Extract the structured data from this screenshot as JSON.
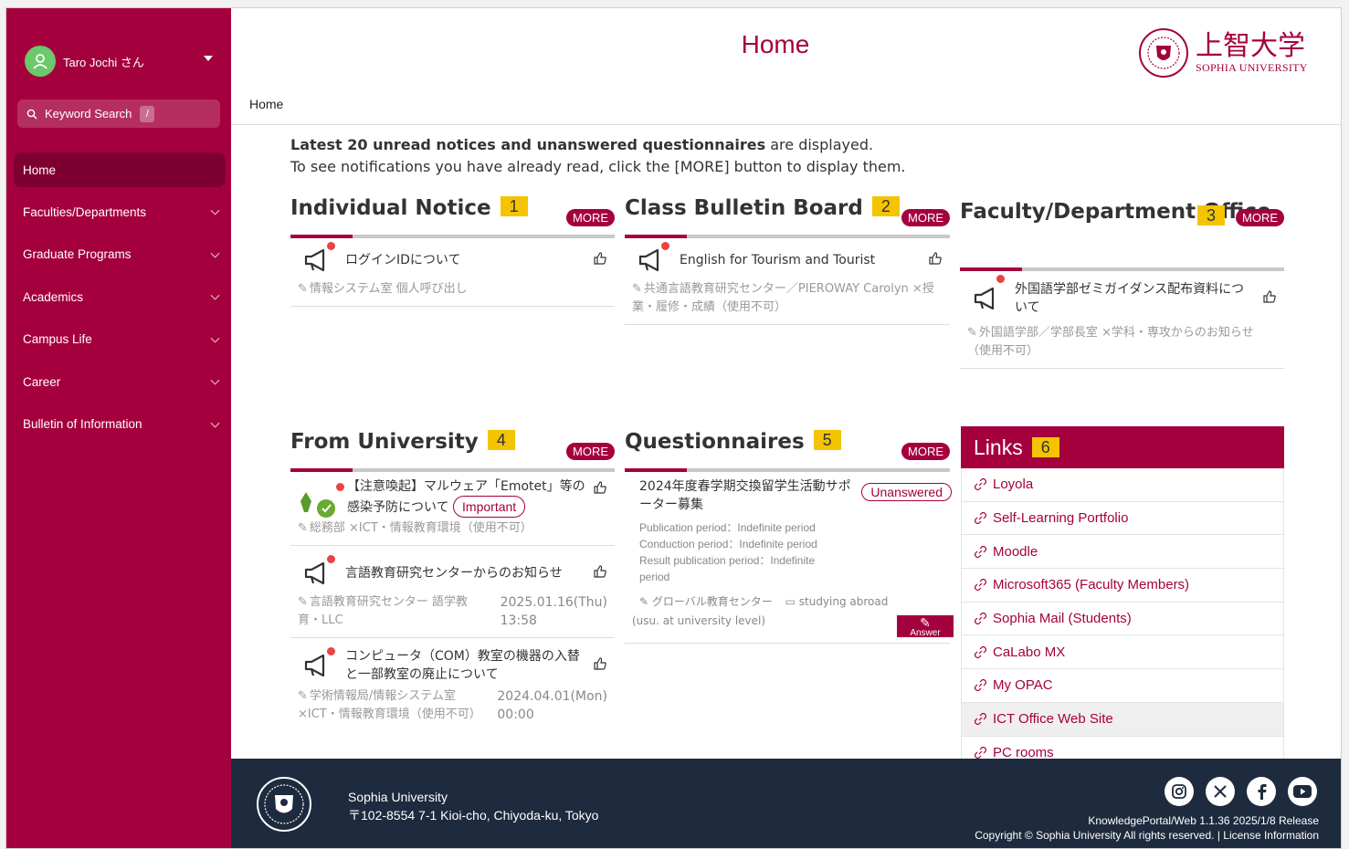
{
  "user": {
    "name": "Taro Jochi さん"
  },
  "search": {
    "label": "Keyword Search",
    "shortcut": "/"
  },
  "nav": [
    {
      "label": "Home"
    },
    {
      "label": "Faculties/Departments"
    },
    {
      "label": "Graduate Programs"
    },
    {
      "label": "Academics"
    },
    {
      "label": "Campus Life"
    },
    {
      "label": "Career"
    },
    {
      "label": "Bulletin of Information"
    }
  ],
  "header": {
    "title": "Home",
    "breadcrumb": "Home",
    "logo_jp": "上智大学",
    "logo_en": "SOPHIA UNIVERSITY"
  },
  "intro": {
    "bold": "Latest 20 unread notices and unanswered questionnaires",
    "rest": " are displayed.",
    "line2": "To see notifications you have already read, click the [MORE] button to display them."
  },
  "more_label": "MORE",
  "panels": {
    "individual": {
      "title": "Individual Notice",
      "num": "1",
      "items": [
        {
          "title": "ログインIDについて",
          "meta": "情報システム室 個人呼び出し"
        }
      ]
    },
    "class": {
      "title": "Class Bulletin Board",
      "num": "2",
      "items": [
        {
          "title": "English for Tourism and Tourist",
          "meta": "共通言語教育研究センター／PIEROWAY Carolyn ×授業・履修・成績（使用不可）"
        }
      ]
    },
    "faculty": {
      "title": "Faculty/Department Office",
      "num": "3",
      "items": [
        {
          "title": "外国語学部ゼミガイダンス配布資料について",
          "meta": "外国語学部／学部長室 ×学科・専攻からのお知らせ（使用不可）"
        }
      ]
    },
    "university": {
      "title": "From University",
      "num": "4",
      "items": [
        {
          "title": "【注意喚起】マルウェア「Emotet」等の感染予防について",
          "badge": "Important",
          "meta": "総務部 ×ICT・情報教育環境（使用不可）",
          "date": "",
          "time": ""
        },
        {
          "title": "言語教育研究センターからのお知らせ",
          "meta": "言語教育研究センター 語学教育・LLC",
          "date": "2025.01.16(Thu)",
          "time": "13:58"
        },
        {
          "title": "コンピュータ（COM）教室の機器の入替と一部教室の廃止について",
          "meta": "学術情報局/情報システム室 ×ICT・情報教育環境（使用不可）",
          "date": "2024.04.01(Mon)",
          "time": "00:00"
        }
      ]
    },
    "questionnaires": {
      "title": "Questionnaires",
      "num": "5",
      "items": [
        {
          "title": "2024年度春学期交換留学生活動サポーター募集",
          "status": "Unanswered",
          "publication": "Publication period：Indefinite period",
          "conduction": "Conduction period：Indefinite period",
          "result": "Result publication period：Indefinite period",
          "sender": "グローバル教育センター",
          "category": "studying abroad (usu. at university level)",
          "answer": "Answer"
        }
      ]
    },
    "links": {
      "title": "Links",
      "num": "6",
      "items": [
        "Loyola",
        "Self-Learning Portfolio",
        "Moodle",
        "Microsoft365 (Faculty Members)",
        "Sophia Mail (Students)",
        "CaLabo MX",
        "My OPAC",
        "ICT Office Web Site",
        "PC rooms"
      ]
    }
  },
  "footer": {
    "name": "Sophia University",
    "address": "〒102-8554 7-1 Kioi-cho, Chiyoda-ku, Tokyo",
    "release": "KnowledgePortal/Web 1.1.36 2025/1/8 Release",
    "copyright": "Copyright © Sophia University All rights reserved. | License Information",
    "icons": [
      "instagram-icon",
      "x-icon",
      "facebook-icon",
      "youtube-icon"
    ]
  },
  "colors": {
    "brand": "#a5003e",
    "badge": "#f5c400",
    "footer": "#1e2a3e"
  }
}
